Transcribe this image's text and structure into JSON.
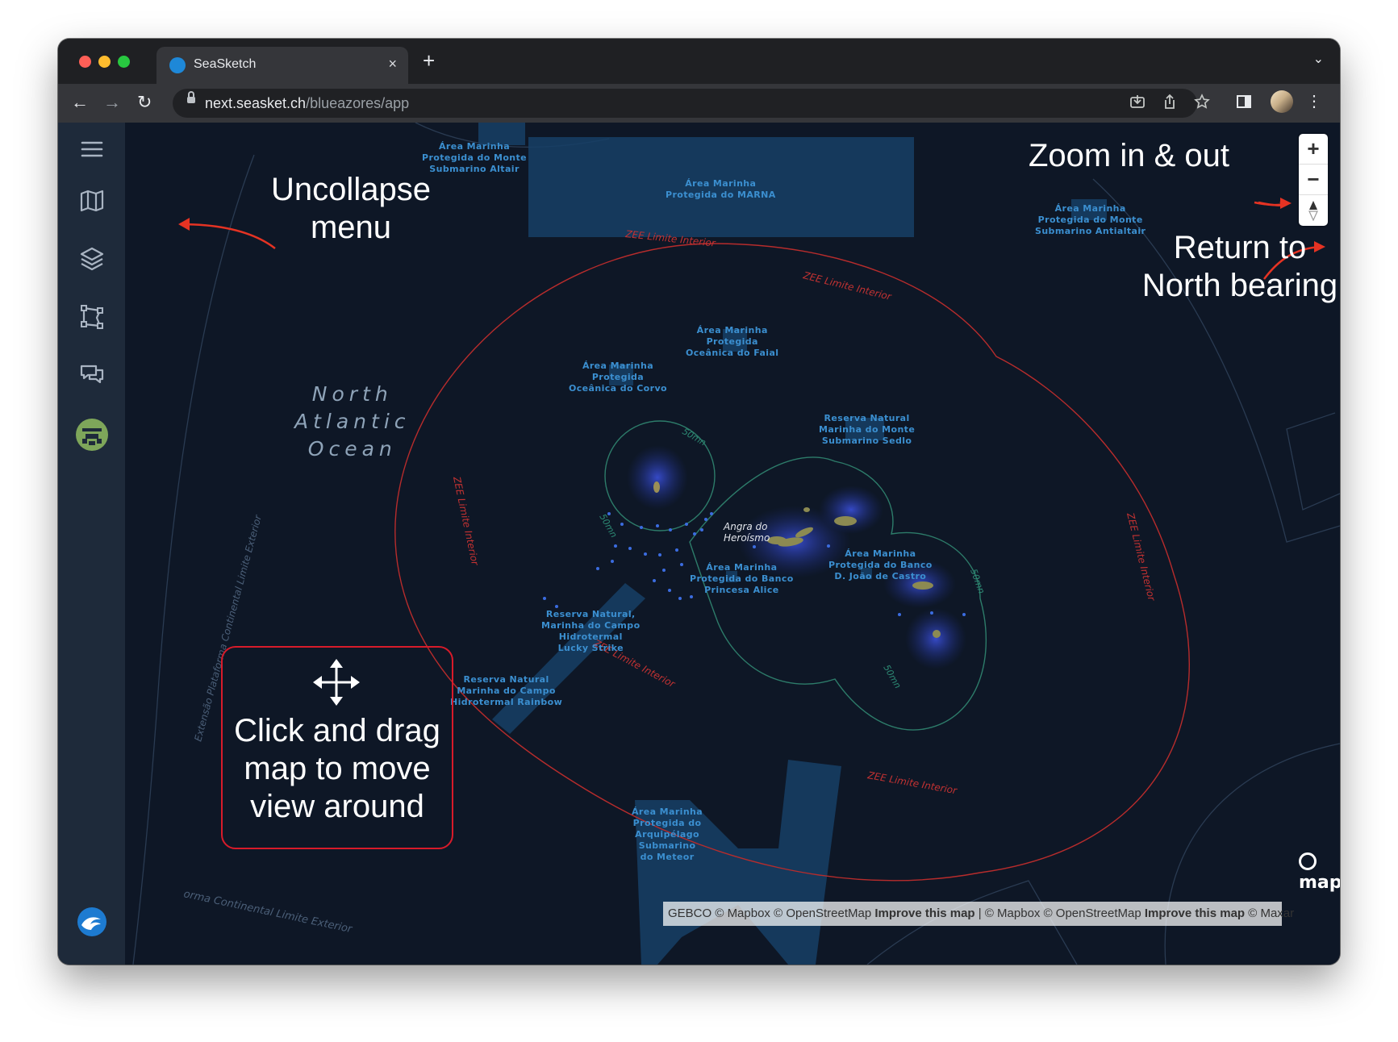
{
  "browser": {
    "tab_title": "SeaSketch",
    "tab_close": "×",
    "new_tab": "+",
    "tabs_menu": "⌄",
    "url_host": "next.seasket.ch",
    "url_path": "/blueazores/app",
    "back": "←",
    "forward": "→",
    "reload": "↻"
  },
  "sidebar": {
    "items": [
      {
        "name": "menu-icon"
      },
      {
        "name": "map-icon"
      },
      {
        "name": "layers-icon"
      },
      {
        "name": "sketch-icon"
      },
      {
        "name": "forum-icon"
      },
      {
        "name": "project-avatar-icon"
      },
      {
        "name": "seasketch-logo-icon"
      }
    ]
  },
  "map": {
    "ocean_label": [
      "North",
      "Atlantic",
      "Ocean"
    ],
    "city_label": [
      "Angra do",
      "Heroísmo"
    ],
    "areas": [
      {
        "lines": [
          "Área Marinha",
          "Protegida do Monte",
          "Submarino Altair"
        ]
      },
      {
        "lines": [
          "Área Marinha",
          "Protegida do MARNA"
        ]
      },
      {
        "lines": [
          "Área Marinha",
          "Protegida do Monte",
          "Submarino Antialtair"
        ]
      },
      {
        "lines": [
          "Área Marinha",
          "Protegida",
          "Oceânica do Faial"
        ]
      },
      {
        "lines": [
          "Área Marinha",
          "Protegida",
          "Oceânica do Corvo"
        ]
      },
      {
        "lines": [
          "Reserva Natural",
          "Marinha do Monte",
          "Submarino Sedlo"
        ]
      },
      {
        "lines": [
          "Área Marinha",
          "Protegida do Banco",
          "D. João de Castro"
        ]
      },
      {
        "lines": [
          "Área Marinha",
          "Protegida do Banco",
          "Princesa Alice"
        ]
      },
      {
        "lines": [
          "Reserva Natural,",
          "Marinha do Campo",
          "Hidrotermal",
          "Lucky Strike"
        ]
      },
      {
        "lines": [
          "Reserva Natural",
          "Marinha do Campo",
          "Hidrotermal Rainbow"
        ]
      },
      {
        "lines": [
          "Área Marinha",
          "Protegida do",
          "Arquipélago",
          "Submarino",
          "do Meteor"
        ]
      }
    ],
    "zee_label": "ZEE Limite Interior",
    "shelf_label": "Extensão Plataforma Continental Limite Exterior",
    "shelf_label_bottom": "orma Continental Limite Exterior",
    "contour_label": "50mn",
    "mapbox": "mapbox",
    "attribution": {
      "part1": "GEBCO © Mapbox © OpenStreetMap",
      "improve1": "Improve this map",
      "part2": "| © Mapbox © OpenStreetMap",
      "improve2": "Improve this map",
      "part3": "© Maxar"
    }
  },
  "controls": {
    "zoom_in": "+",
    "zoom_out": "−",
    "compass": "▲"
  },
  "annotations": {
    "uncollapse": [
      "Uncollapse",
      "menu"
    ],
    "zoom": "Zoom in & out",
    "north": [
      "Return to",
      "North bearing"
    ],
    "drag": [
      "Click and drag",
      "map to move",
      "view around"
    ]
  },
  "colors": {
    "accent_red": "#e53323",
    "sidebar_bg": "#1e2a3a",
    "map_bg": "#0e1726",
    "mpa_fill": "#163f66",
    "label_blue": "#3b8fd0"
  }
}
